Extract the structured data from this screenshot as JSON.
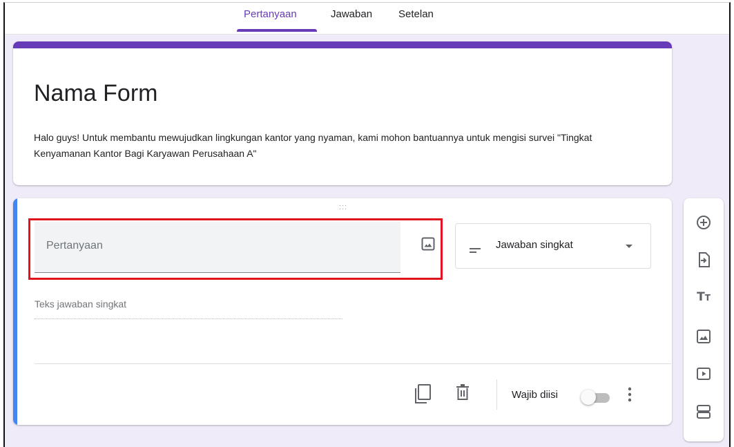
{
  "tabs": [
    {
      "label": "Pertanyaan",
      "active": true
    },
    {
      "label": "Jawaban",
      "active": false
    },
    {
      "label": "Setelan",
      "active": false
    }
  ],
  "form": {
    "title": "Nama Form",
    "description": "Halo guys! Untuk membantu mewujudkan lingkungan kantor yang nyaman, kami mohon bantuannya untuk mengisi survei \"Tingkat Kenyamanan Kantor Bagi Karyawan Perusahaan A\""
  },
  "question": {
    "placeholder": "Pertanyaan",
    "type_label": "Jawaban singkat",
    "answer_placeholder": "Teks jawaban singkat",
    "required_label": "Wajib diisi",
    "required": false
  },
  "footer_icons": [
    "duplicate-icon",
    "trash-icon",
    "more-vert-icon"
  ],
  "toolbar": [
    "add-question-icon",
    "import-questions-icon",
    "add-title-icon",
    "add-image-icon",
    "add-video-icon",
    "add-section-icon"
  ],
  "colors": {
    "accent": "#673ab7",
    "active_question_bar": "#4285f4",
    "highlight_box": "#e0141e",
    "background": "#f0ebf8"
  }
}
